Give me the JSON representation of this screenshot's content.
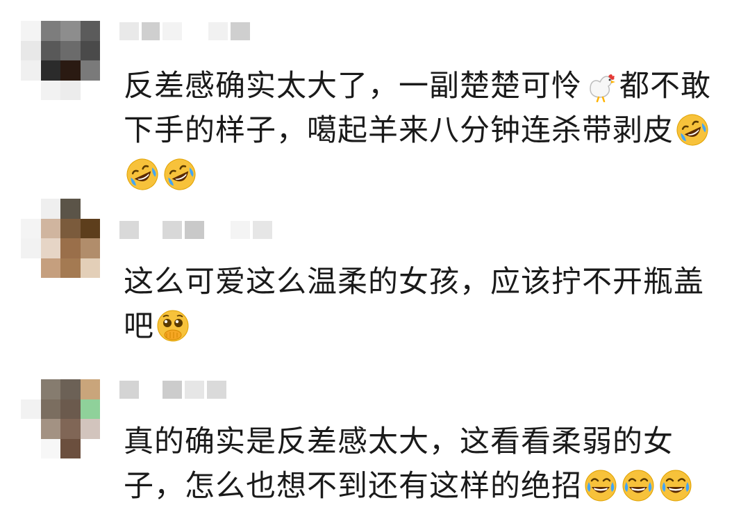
{
  "comments": [
    {
      "username": "",
      "parts": [
        {
          "text": "反差感确实太大了，一副楚楚可怜"
        },
        {
          "emoji": "chicken-emoji"
        },
        {
          "text": "都不敢下手的样子，噶起羊来八分钟连杀带剥皮"
        },
        {
          "emoji": "rolling-laughing-emoji"
        },
        {
          "emoji": "rolling-laughing-emoji"
        },
        {
          "emoji": "rolling-laughing-emoji"
        }
      ]
    },
    {
      "username": "",
      "parts": [
        {
          "text": "这么可爱这么温柔的女孩，应该拧不开瓶盖吧"
        },
        {
          "emoji": "pleading-covering-mouth-emoji"
        }
      ]
    },
    {
      "username": "",
      "parts": [
        {
          "text": "真的确实是反差感太大，这看看柔弱的女子，怎么也想不到还有这样的绝招"
        },
        {
          "emoji": "tears-of-joy-emoji"
        },
        {
          "emoji": "tears-of-joy-emoji"
        },
        {
          "emoji": "tears-of-joy-emoji"
        }
      ]
    }
  ],
  "colors": {
    "text": "#1a1a1a",
    "background": "#ffffff",
    "emoji_yellow": "#f7c23b"
  }
}
